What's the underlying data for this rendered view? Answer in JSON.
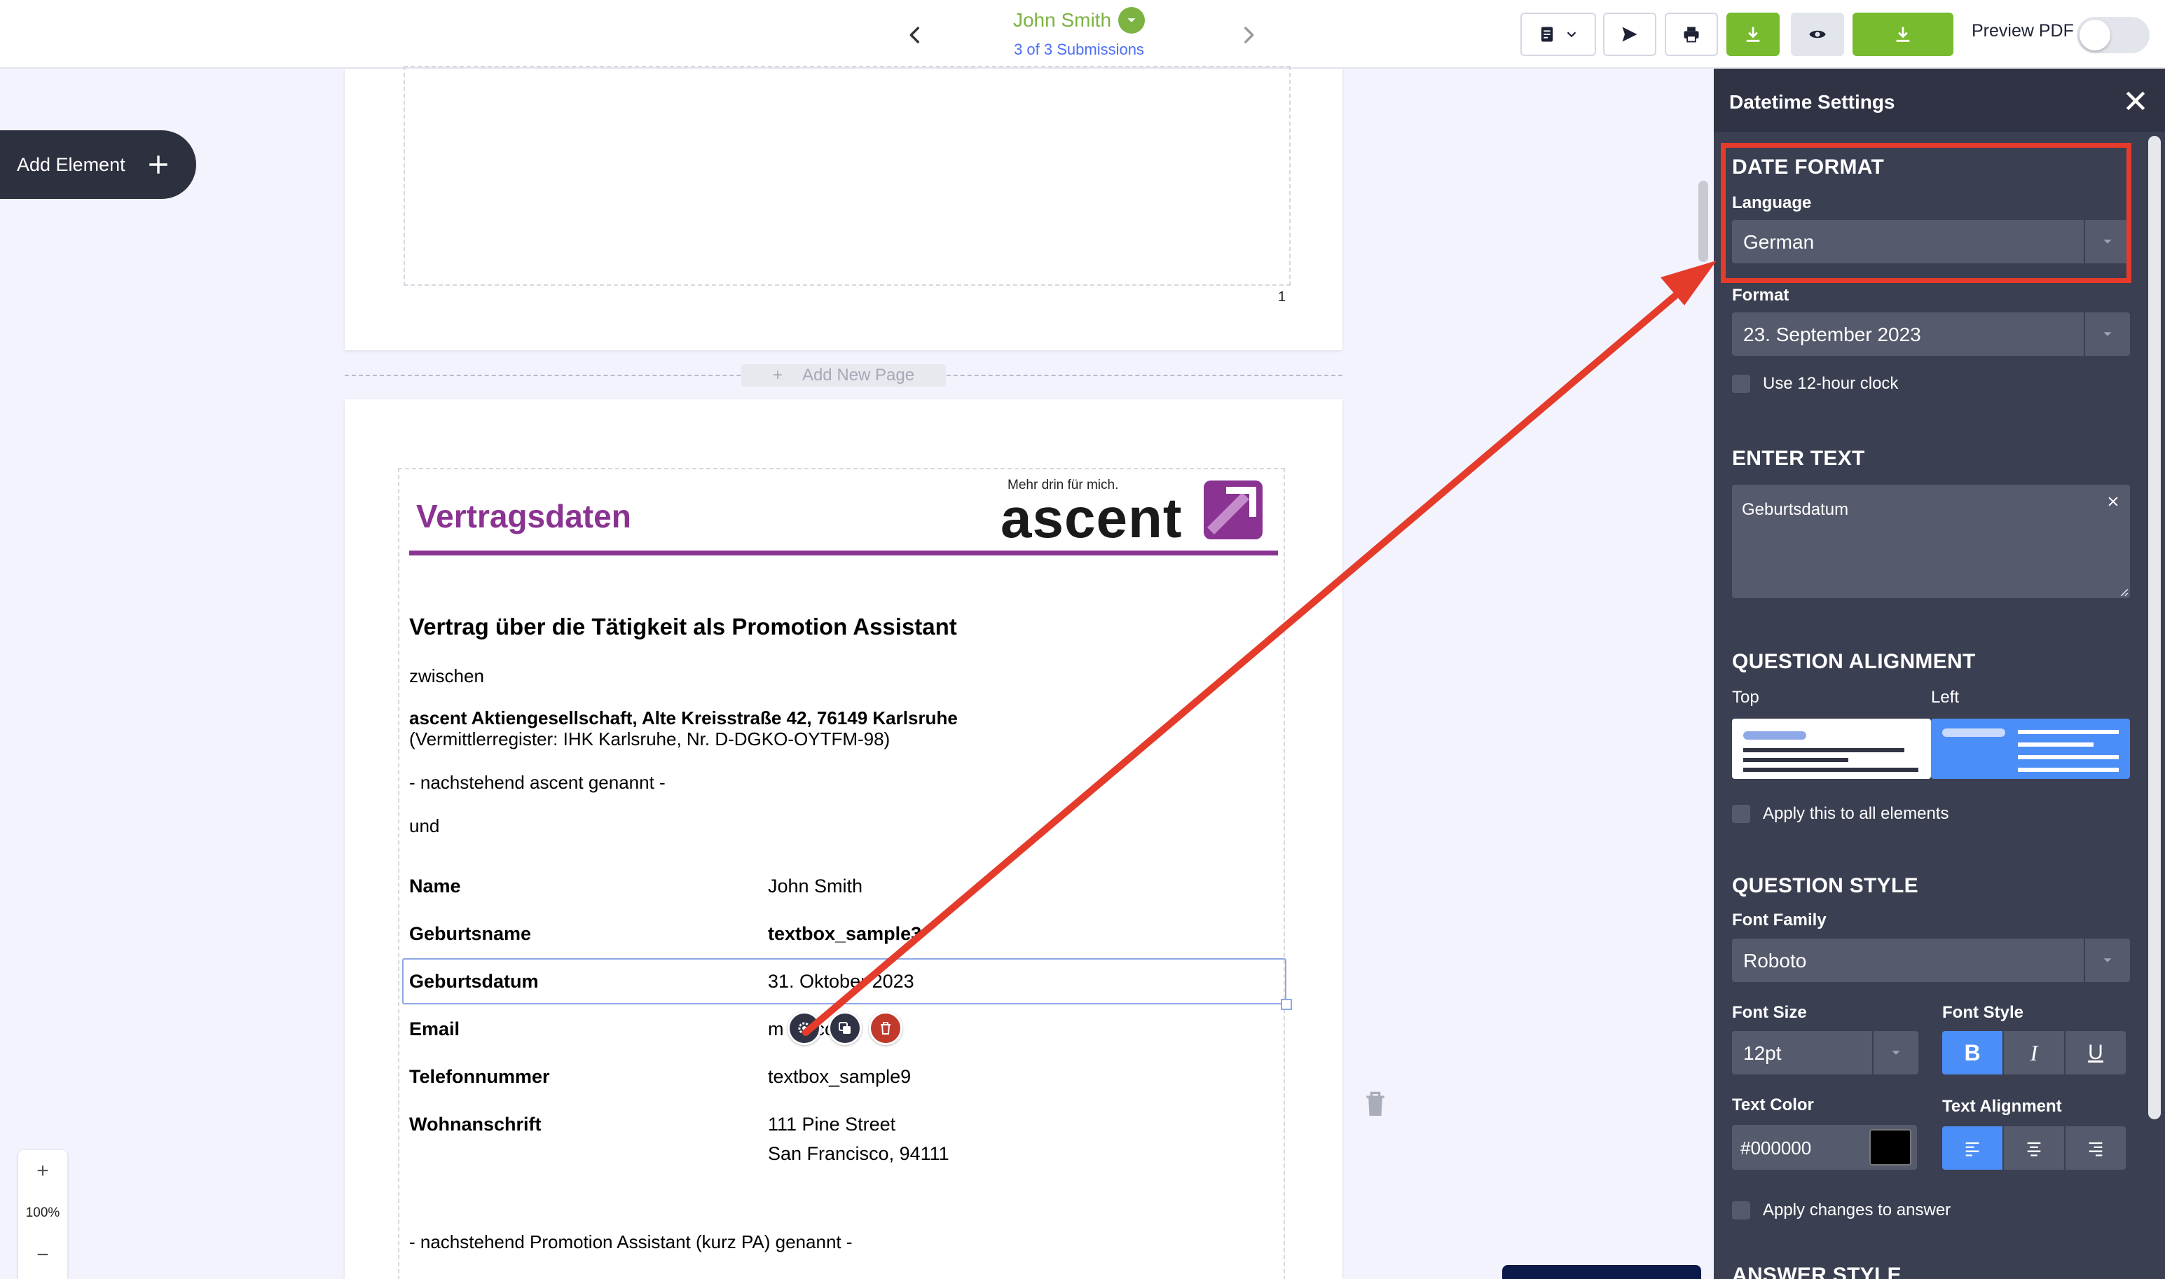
{
  "topbar": {
    "submitter_name": "John Smith",
    "submission_count": "3 of 3 Submissions",
    "preview_label": "Preview PDF",
    "preview_enabled": false,
    "accent_green": "#78bb2e"
  },
  "sidebar": {
    "add_element_label": "Add Element"
  },
  "zoom": {
    "plus": "+",
    "value": "100%",
    "minus": "−"
  },
  "pages": {
    "page1_number": "1",
    "add_new_page_label": "Add New Page"
  },
  "document": {
    "title": "Vertragsdaten",
    "logo_tagline": "Mehr drin für mich.",
    "logo_word": "ascent",
    "heading": "Vertrag über die Tätigkeit als Promotion Assistant",
    "between": "zwischen",
    "company": "ascent Aktiengesellschaft, Alte Kreisstraße 42, 76149 Karlsruhe",
    "register": "(Vermittlerregister: IHK Karlsruhe, Nr. D-DGKO-OYTFM-98)",
    "hereinafter_ascent": "- nachstehend ascent genannt -",
    "and": "und",
    "fields": [
      {
        "label": "Name",
        "value": "John Smith",
        "bold_value": false
      },
      {
        "label": "Geburtsname",
        "value": "textbox_sample3",
        "bold_value": true
      },
      {
        "label": "Geburtsdatum",
        "value": "31. Oktober 2023",
        "bold_value": false
      },
      {
        "label": "Email",
        "value": "m            fo       .com",
        "bold_value": false
      },
      {
        "label": "Telefonnummer",
        "value": "textbox_sample9",
        "bold_value": false
      },
      {
        "label": "Wohnanschrift",
        "value": "111 Pine Street",
        "value2": "San Francisco, 94111",
        "bold_value": false
      }
    ],
    "hereinafter_pa": "- nachstehend Promotion Assistant (kurz PA) genannt -"
  },
  "panel": {
    "title": "Datetime Settings",
    "date_format": {
      "section_title": "DATE FORMAT",
      "language_label": "Language",
      "language_value": "German",
      "format_label": "Format",
      "format_value": "23. September 2023",
      "twelve_hour_label": "Use 12-hour clock"
    },
    "enter_text": {
      "section_title": "ENTER TEXT",
      "value": "Geburtsdatum"
    },
    "question_alignment": {
      "section_title": "QUESTION ALIGNMENT",
      "options": [
        "Top",
        "Left"
      ],
      "selected": "Left",
      "apply_all_label": "Apply this to all elements"
    },
    "question_style": {
      "section_title": "QUESTION STYLE",
      "font_family_label": "Font Family",
      "font_family_value": "Roboto",
      "font_size_label": "Font Size",
      "font_size_value": "12pt",
      "font_style_label": "Font Style",
      "font_style_buttons": [
        "B",
        "I",
        "U"
      ],
      "text_color_label": "Text Color",
      "text_color_value": "#000000",
      "text_alignment_label": "Text Alignment",
      "apply_answer_label": "Apply changes to answer"
    },
    "answer_style": {
      "section_title": "ANSWER STYLE"
    },
    "colors": {
      "panel_bg": "#3a3f51",
      "active_blue": "#4c8ef7"
    }
  },
  "annotation": {
    "color": "#e43b2a"
  }
}
